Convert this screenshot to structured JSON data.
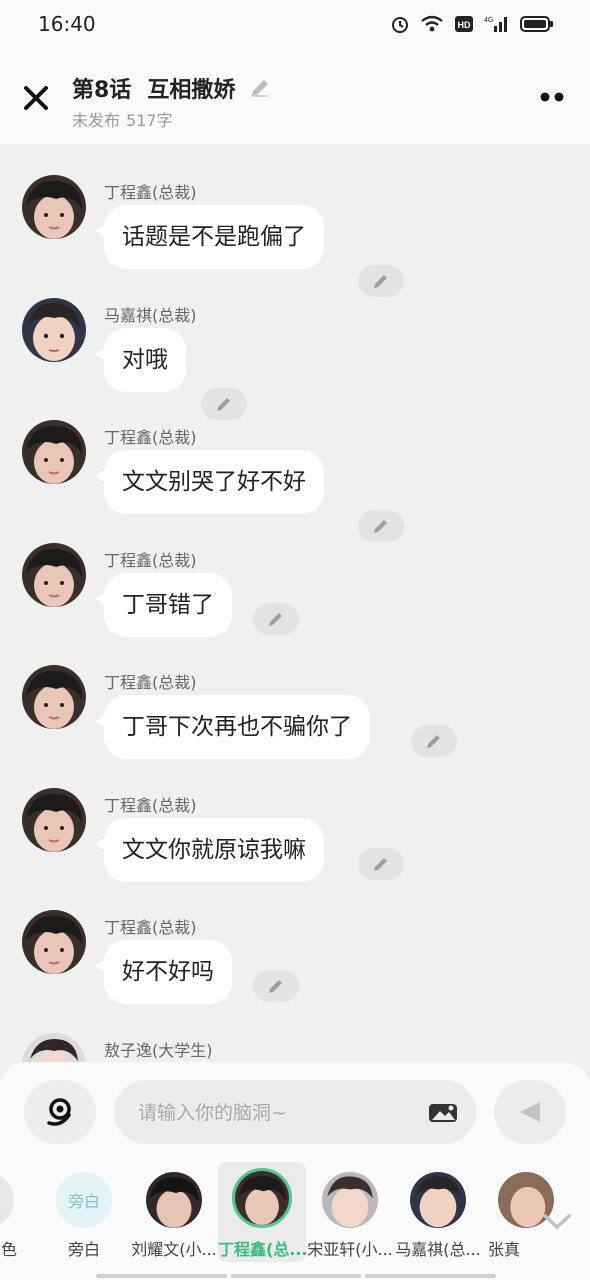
{
  "status": {
    "time": "16:40"
  },
  "header": {
    "episode": "第8话",
    "title": "互相撒娇",
    "status": "未发布",
    "word_count": "517字"
  },
  "messages": [
    {
      "name": "丁程鑫(总裁)",
      "text": "话题是不是跑偏了",
      "avatar": "dcx"
    },
    {
      "name": "马嘉祺(总裁)",
      "text": "对哦",
      "avatar": "mjq"
    },
    {
      "name": "丁程鑫(总裁)",
      "text": "文文别哭了好不好",
      "avatar": "dcx"
    },
    {
      "name": "丁程鑫(总裁)",
      "text": "丁哥错了",
      "avatar": "dcx"
    },
    {
      "name": "丁程鑫(总裁)",
      "text": "丁哥下次再也不骗你了",
      "avatar": "dcx"
    },
    {
      "name": "丁程鑫(总裁)",
      "text": "文文你就原谅我嘛",
      "avatar": "dcx"
    },
    {
      "name": "丁程鑫(总裁)",
      "text": "好不好吗",
      "avatar": "dcx"
    },
    {
      "name": "敖子逸(大学生)",
      "text": "",
      "avatar": "azy"
    }
  ],
  "input": {
    "placeholder": "请输入你的脑洞~"
  },
  "roles": [
    {
      "label": "角色",
      "avatar": "partial"
    },
    {
      "label": "旁白",
      "avatar_text": "旁白"
    },
    {
      "label": "刘耀文(小...",
      "avatar": "lyw"
    },
    {
      "label": "丁程鑫(总...",
      "avatar": "dcx",
      "selected": true
    },
    {
      "label": "宋亚轩(小...",
      "avatar": "syx"
    },
    {
      "label": "马嘉祺(总...",
      "avatar": "mjq"
    },
    {
      "label": "张真",
      "avatar": "zzy"
    }
  ],
  "colors": {
    "accent": "#3dbb7f",
    "background": "#f0f0f0",
    "bubble": "#ffffff"
  }
}
